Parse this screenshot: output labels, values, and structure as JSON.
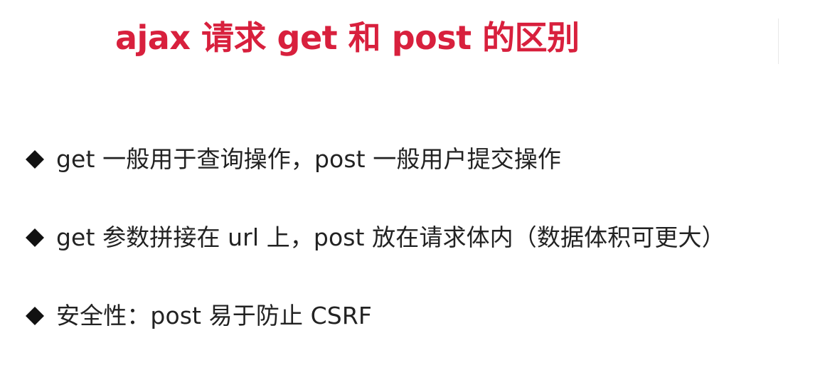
{
  "title": "ajax 请求 get 和 post 的区别",
  "bullets": [
    {
      "text": "get 一般用于查询操作，post 一般用户提交操作"
    },
    {
      "text": "get 参数拼接在 url 上，post 放在请求体内（数据体积可更大）"
    },
    {
      "text": "安全性：post 易于防止 CSRF"
    }
  ],
  "colors": {
    "title": "#d8203d",
    "text": "#222222",
    "bullet_icon": "#111111"
  },
  "icons": {
    "bullet_marker": "diamond-icon"
  }
}
